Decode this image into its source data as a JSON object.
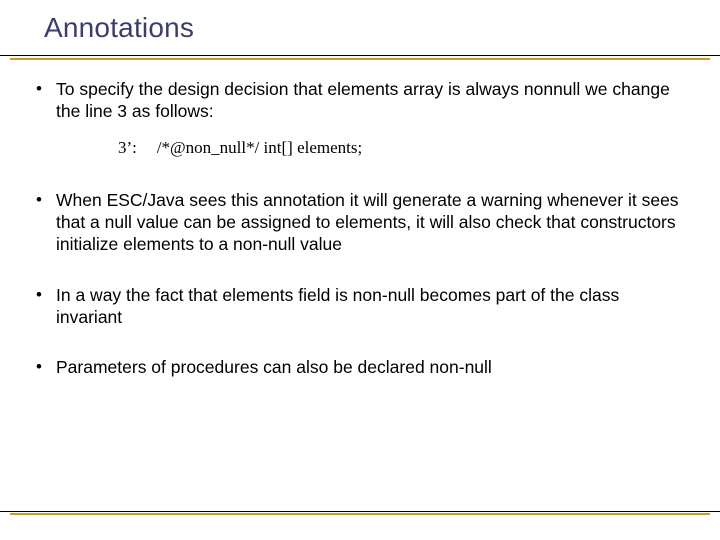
{
  "title": "Annotations",
  "bullets": {
    "b1": "To specify the design decision that elements array is always nonnull we change the line 3 as follows:",
    "b2": "When ESC/Java sees this annotation it will generate a warning whenever it sees that a null value can be assigned to elements, it will also check that constructors initialize elements to a non-null value",
    "b3": "In a way the fact that elements field is non-null becomes part of the class invariant",
    "b4": "Parameters of procedures can also be declared non-null"
  },
  "code": {
    "label": "3’:",
    "text": "/*@non_null*/ int[] elements;"
  }
}
